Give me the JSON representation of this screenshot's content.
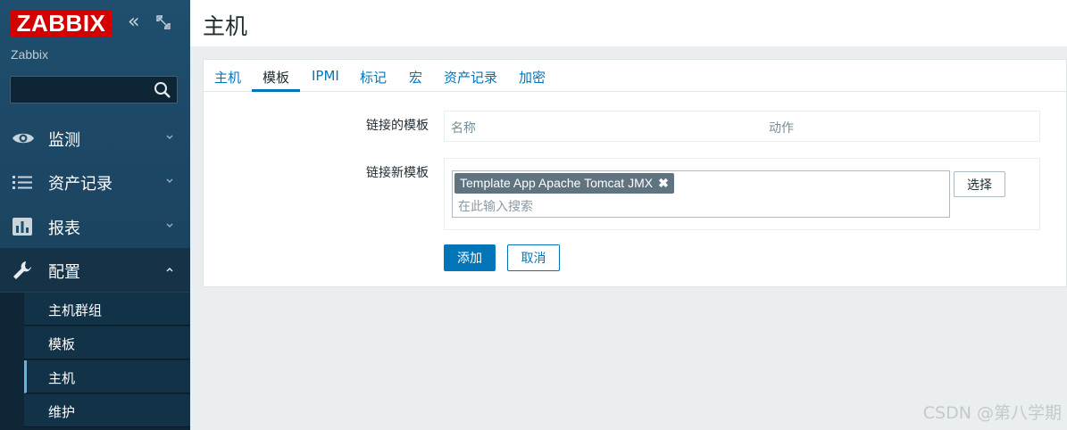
{
  "sidebar": {
    "logo": "ZABBIX",
    "subtitle": "Zabbix",
    "collapse_glyph": "«",
    "search_value": "",
    "menu": [
      {
        "label": "监测",
        "icon": "eye-icon"
      },
      {
        "label": "资产记录",
        "icon": "list-icon"
      },
      {
        "label": "报表",
        "icon": "bar-chart-icon"
      },
      {
        "label": "配置",
        "icon": "wrench-icon"
      }
    ],
    "submenu": [
      {
        "label": "主机群组"
      },
      {
        "label": "模板"
      },
      {
        "label": "主机"
      },
      {
        "label": "维护"
      }
    ]
  },
  "page": {
    "title": "主机"
  },
  "tabs": [
    {
      "label": "主机"
    },
    {
      "label": "模板"
    },
    {
      "label": "IPMI"
    },
    {
      "label": "标记"
    },
    {
      "label": "宏"
    },
    {
      "label": "资产记录"
    },
    {
      "label": "加密"
    }
  ],
  "form": {
    "linked_label": "链接的模板",
    "linked_columns": {
      "name": "名称",
      "action": "动作"
    },
    "new_label": "链接新模板",
    "selected_template": "Template App Apache Tomcat JMX",
    "chip_remove": "✖",
    "search_placeholder": "在此输入搜索",
    "select_button": "选择",
    "add_button": "添加",
    "cancel_button": "取消"
  },
  "watermark": "CSDN @第八学期",
  "colors": {
    "brand_red": "#d40000",
    "accent_blue": "#0275b8",
    "sidebar_bg": "#1f4662"
  }
}
